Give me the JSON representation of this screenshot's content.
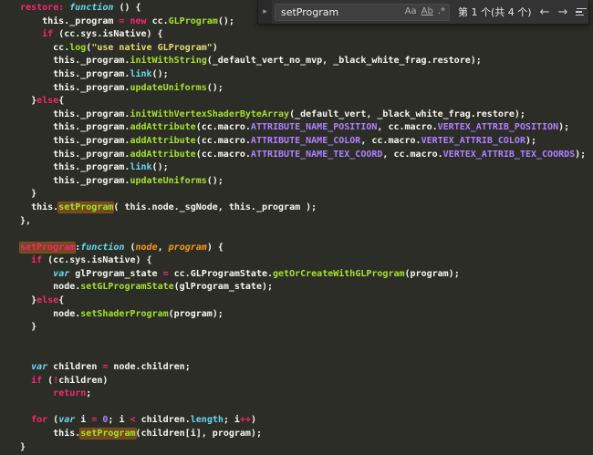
{
  "find_widget": {
    "query": "setProgram",
    "results_count": "第 1 个(共 4 个)",
    "toggles": {
      "match_case": "Aa",
      "whole_word": "Ab",
      "regex": ".*"
    },
    "buttons": {
      "expand": "▸",
      "prev": "←",
      "next": "→",
      "close": "✕"
    }
  },
  "colors": {
    "editor_background": "#2d2d28",
    "foreground": "#f8f8f2",
    "keyword_pink": "#f92672",
    "function_green": "#a6e22e",
    "support_cyan": "#66d9ef",
    "string_yellow": "#e6db74",
    "constant_purple": "#ae81ff",
    "param_orange": "#fd971f",
    "match_highlight": "#71491c"
  },
  "code": {
    "lines": [
      [
        {
          "t": "  ",
          "s": "w"
        },
        {
          "t": "restore:",
          "s": "p"
        },
        {
          "t": " ",
          "s": "w"
        },
        {
          "t": "function",
          "s": "c",
          "it": true
        },
        {
          "t": " () {",
          "s": "w"
        }
      ],
      [
        {
          "t": "      this._program ",
          "s": "w"
        },
        {
          "t": "=",
          "s": "p"
        },
        {
          "t": " ",
          "s": "w"
        },
        {
          "t": "new",
          "s": "p"
        },
        {
          "t": " cc.",
          "s": "w"
        },
        {
          "t": "GLProgram",
          "s": "g"
        },
        {
          "t": "();",
          "s": "w"
        }
      ],
      [
        {
          "t": "      ",
          "s": "w"
        },
        {
          "t": "if",
          "s": "p"
        },
        {
          "t": " (cc.sys.isNative) {",
          "s": "w"
        }
      ],
      [
        {
          "t": "        cc.",
          "s": "w"
        },
        {
          "t": "log",
          "s": "g"
        },
        {
          "t": "(",
          "s": "w"
        },
        {
          "t": "\"use native GLProgram\"",
          "s": "y"
        },
        {
          "t": ")",
          "s": "w"
        }
      ],
      [
        {
          "t": "        this._program.",
          "s": "w"
        },
        {
          "t": "initWithString",
          "s": "g"
        },
        {
          "t": "(_default_vert_no_mvp, _black_white_frag.restore);",
          "s": "w"
        }
      ],
      [
        {
          "t": "        this._program.",
          "s": "w"
        },
        {
          "t": "link",
          "s": "c"
        },
        {
          "t": "();",
          "s": "w"
        }
      ],
      [
        {
          "t": "        this._program.",
          "s": "w"
        },
        {
          "t": "updateUniforms",
          "s": "g"
        },
        {
          "t": "();",
          "s": "w"
        }
      ],
      [
        {
          "t": "    }",
          "s": "w"
        },
        {
          "t": "else",
          "s": "p"
        },
        {
          "t": "{",
          "s": "w"
        }
      ],
      [
        {
          "t": "        this._program.",
          "s": "w"
        },
        {
          "t": "initWithVertexShaderByteArray",
          "s": "g"
        },
        {
          "t": "(_default_vert, _black_white_frag.restore);",
          "s": "w"
        }
      ],
      [
        {
          "t": "        this._program.",
          "s": "w"
        },
        {
          "t": "addAttribute",
          "s": "g"
        },
        {
          "t": "(cc.macro.",
          "s": "w"
        },
        {
          "t": "ATTRIBUTE_NAME_POSITION",
          "s": "u"
        },
        {
          "t": ", cc.macro.",
          "s": "w"
        },
        {
          "t": "VERTEX_ATTRIB_POSITION",
          "s": "u"
        },
        {
          "t": ");",
          "s": "w"
        }
      ],
      [
        {
          "t": "        this._program.",
          "s": "w"
        },
        {
          "t": "addAttribute",
          "s": "g"
        },
        {
          "t": "(cc.macro.",
          "s": "w"
        },
        {
          "t": "ATTRIBUTE_NAME_COLOR",
          "s": "u"
        },
        {
          "t": ", cc.macro.",
          "s": "w"
        },
        {
          "t": "VERTEX_ATTRIB_COLOR",
          "s": "u"
        },
        {
          "t": ");",
          "s": "w"
        }
      ],
      [
        {
          "t": "        this._program.",
          "s": "w"
        },
        {
          "t": "addAttribute",
          "s": "g"
        },
        {
          "t": "(cc.macro.",
          "s": "w"
        },
        {
          "t": "ATTRIBUTE_NAME_TEX_COORD",
          "s": "u"
        },
        {
          "t": ", cc.macro.",
          "s": "w"
        },
        {
          "t": "VERTEX_ATTRIB_TEX_COORDS",
          "s": "u"
        },
        {
          "t": ");",
          "s": "w"
        }
      ],
      [
        {
          "t": "        this._program.",
          "s": "w"
        },
        {
          "t": "link",
          "s": "c"
        },
        {
          "t": "();",
          "s": "w"
        }
      ],
      [
        {
          "t": "        this._program.",
          "s": "w"
        },
        {
          "t": "updateUniforms",
          "s": "g"
        },
        {
          "t": "();",
          "s": "w"
        }
      ],
      [
        {
          "t": "    }",
          "s": "w"
        }
      ],
      [
        {
          "t": "    this.",
          "s": "w"
        },
        {
          "t": "setProgram",
          "s": "g",
          "hl": true
        },
        {
          "t": "( this.node._sgNode, this._program );",
          "s": "w"
        }
      ],
      [
        {
          "t": "  },",
          "s": "w"
        }
      ],
      [],
      [
        {
          "t": "  ",
          "s": "w"
        },
        {
          "t": "setProgram",
          "s": "p",
          "hl": true
        },
        {
          "t": ":",
          "s": "w"
        },
        {
          "t": "function",
          "s": "c",
          "it": true
        },
        {
          "t": " (",
          "s": "w"
        },
        {
          "t": "node",
          "s": "o",
          "it": true
        },
        {
          "t": ", ",
          "s": "w"
        },
        {
          "t": "program",
          "s": "o",
          "it": true
        },
        {
          "t": ") {",
          "s": "w"
        }
      ],
      [
        {
          "t": "    ",
          "s": "w"
        },
        {
          "t": "if",
          "s": "p"
        },
        {
          "t": " (cc.sys.isNative) {",
          "s": "w"
        }
      ],
      [
        {
          "t": "        ",
          "s": "w"
        },
        {
          "t": "var",
          "s": "c",
          "it": true
        },
        {
          "t": " glProgram_state ",
          "s": "w"
        },
        {
          "t": "=",
          "s": "p"
        },
        {
          "t": " cc.GLProgramState.",
          "s": "w"
        },
        {
          "t": "getOrCreateWithGLProgram",
          "s": "g"
        },
        {
          "t": "(program);",
          "s": "w"
        }
      ],
      [
        {
          "t": "        node.",
          "s": "w"
        },
        {
          "t": "setGLProgramState",
          "s": "g"
        },
        {
          "t": "(glProgram_state);",
          "s": "w"
        }
      ],
      [
        {
          "t": "    }",
          "s": "w"
        },
        {
          "t": "else",
          "s": "p"
        },
        {
          "t": "{",
          "s": "w"
        }
      ],
      [
        {
          "t": "        node.",
          "s": "w"
        },
        {
          "t": "setShaderProgram",
          "s": "g"
        },
        {
          "t": "(program);",
          "s": "w"
        }
      ],
      [
        {
          "t": "    }",
          "s": "w"
        }
      ],
      [],
      [],
      [
        {
          "t": "    ",
          "s": "w"
        },
        {
          "t": "var",
          "s": "c",
          "it": true
        },
        {
          "t": " children ",
          "s": "w"
        },
        {
          "t": "=",
          "s": "p"
        },
        {
          "t": " node.children;",
          "s": "w"
        }
      ],
      [
        {
          "t": "    ",
          "s": "w"
        },
        {
          "t": "if",
          "s": "p"
        },
        {
          "t": " (",
          "s": "w"
        },
        {
          "t": "!",
          "s": "p"
        },
        {
          "t": "children)",
          "s": "w"
        }
      ],
      [
        {
          "t": "        ",
          "s": "w"
        },
        {
          "t": "return",
          "s": "p"
        },
        {
          "t": ";",
          "s": "w"
        }
      ],
      [],
      [
        {
          "t": "    ",
          "s": "w"
        },
        {
          "t": "for",
          "s": "p"
        },
        {
          "t": " (",
          "s": "w"
        },
        {
          "t": "var",
          "s": "c",
          "it": true
        },
        {
          "t": " i ",
          "s": "w"
        },
        {
          "t": "=",
          "s": "p"
        },
        {
          "t": " ",
          "s": "w"
        },
        {
          "t": "0",
          "s": "u"
        },
        {
          "t": "; i ",
          "s": "w"
        },
        {
          "t": "<",
          "s": "p"
        },
        {
          "t": " children.",
          "s": "w"
        },
        {
          "t": "length",
          "s": "c"
        },
        {
          "t": "; i",
          "s": "w"
        },
        {
          "t": "++",
          "s": "p"
        },
        {
          "t": ")",
          "s": "w"
        }
      ],
      [
        {
          "t": "        this.",
          "s": "w"
        },
        {
          "t": "setProgram",
          "s": "g",
          "hl": true
        },
        {
          "t": "(children[i], program);",
          "s": "w"
        }
      ],
      [
        {
          "t": "  }",
          "s": "w"
        }
      ]
    ]
  }
}
